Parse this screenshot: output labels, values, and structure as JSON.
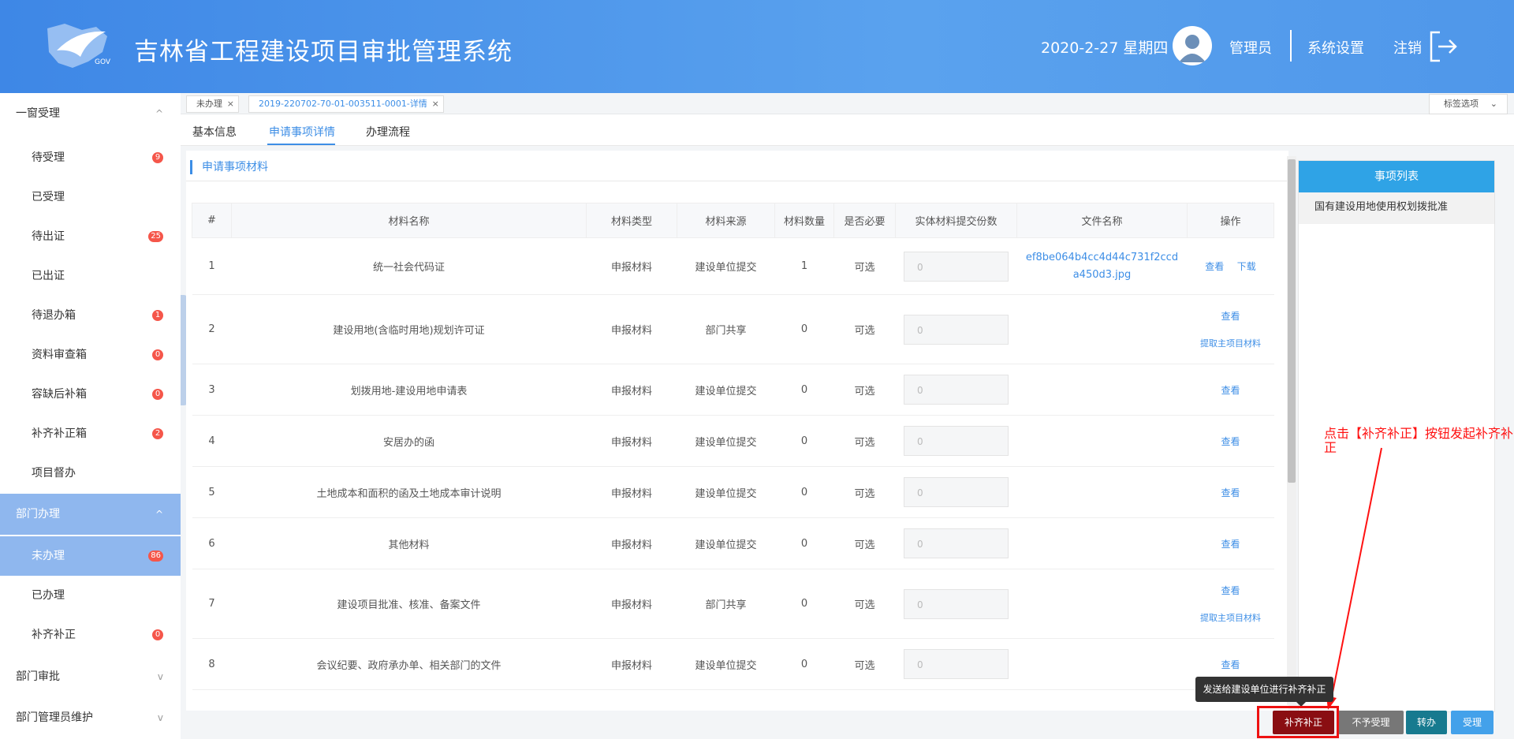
{
  "header": {
    "title": "吉林省工程建设项目审批管理系统",
    "logo_text": "GOV",
    "date": "2020-2-27 星期四",
    "user": "管理员",
    "settings": "系统设置",
    "logout": "注销"
  },
  "sidebar": {
    "groups": [
      {
        "label": "一窗受理",
        "chevron": "^",
        "items": [
          {
            "label": "待受理",
            "badge": "9"
          },
          {
            "label": "已受理",
            "badge": ""
          },
          {
            "label": "待出证",
            "badge": "25"
          },
          {
            "label": "已出证",
            "badge": ""
          },
          {
            "label": "待退办箱",
            "badge": "1"
          },
          {
            "label": "资料审查箱",
            "badge": "0"
          },
          {
            "label": "容缺后补箱",
            "badge": "0"
          },
          {
            "label": "补齐补正箱",
            "badge": "2"
          },
          {
            "label": "项目督办",
            "badge": ""
          }
        ]
      },
      {
        "label": "部门办理",
        "chevron": "^",
        "items": [
          {
            "label": "未办理",
            "badge": "86"
          },
          {
            "label": "已办理",
            "badge": ""
          },
          {
            "label": "补齐补正",
            "badge": "0"
          }
        ]
      },
      {
        "label": "部门审批",
        "chevron": "v"
      },
      {
        "label": "部门管理员维护",
        "chevron": "v"
      }
    ]
  },
  "tabs": [
    {
      "label": "未办理",
      "close": "×"
    },
    {
      "label": "2019-220702-70-01-003511-0001-详情",
      "close": "×"
    }
  ],
  "tab_options": "标签选项",
  "subtabs": [
    "基本信息",
    "申请事项详情",
    "办理流程"
  ],
  "section_title": "申请事项材料",
  "table": {
    "headers": [
      "#",
      "材料名称",
      "材料类型",
      "材料来源",
      "材料数量",
      "是否必要",
      "实体材料提交份数",
      "文件名称",
      "操作"
    ],
    "rows": [
      {
        "no": "1",
        "name": "统一社会代码证",
        "type": "申报材料",
        "source": "建设单位提交",
        "count": "1",
        "required": "可选",
        "copies": "0",
        "file": "ef8be064b4cc4d44c731f2ccda450d3.jpg",
        "ops": [
          "查看",
          "下载"
        ]
      },
      {
        "no": "2",
        "name": "建设用地(含临时用地)规划许可证",
        "type": "申报材料",
        "source": "部门共享",
        "count": "0",
        "required": "可选",
        "copies": "0",
        "file": "",
        "ops": [
          "查看",
          "提取主项目材料"
        ]
      },
      {
        "no": "3",
        "name": "划拨用地-建设用地申请表",
        "type": "申报材料",
        "source": "建设单位提交",
        "count": "0",
        "required": "可选",
        "copies": "0",
        "file": "",
        "ops": [
          "查看"
        ]
      },
      {
        "no": "4",
        "name": "安居办的函",
        "type": "申报材料",
        "source": "建设单位提交",
        "count": "0",
        "required": "可选",
        "copies": "0",
        "file": "",
        "ops": [
          "查看"
        ]
      },
      {
        "no": "5",
        "name": "土地成本和面积的函及土地成本审计说明",
        "type": "申报材料",
        "source": "建设单位提交",
        "count": "0",
        "required": "可选",
        "copies": "0",
        "file": "",
        "ops": [
          "查看"
        ]
      },
      {
        "no": "6",
        "name": "其他材料",
        "type": "申报材料",
        "source": "建设单位提交",
        "count": "0",
        "required": "可选",
        "copies": "0",
        "file": "",
        "ops": [
          "查看"
        ]
      },
      {
        "no": "7",
        "name": "建设项目批准、核准、备案文件",
        "type": "申报材料",
        "source": "部门共享",
        "count": "0",
        "required": "可选",
        "copies": "0",
        "file": "",
        "ops": [
          "查看",
          "提取主项目材料"
        ]
      },
      {
        "no": "8",
        "name": "会议纪要、政府承办单、相关部门的文件",
        "type": "申报材料",
        "source": "建设单位提交",
        "count": "0",
        "required": "可选",
        "copies": "0",
        "file": "",
        "ops": [
          "查看"
        ]
      }
    ]
  },
  "right_panel": {
    "title": "事项列表",
    "items": [
      "国有建设用地使用权划拨批准"
    ]
  },
  "tooltip": "发送给建设单位进行补齐补正",
  "buttons": {
    "supplement": "补齐补正",
    "reject": "不予受理",
    "transfer": "转办",
    "accept": "受理"
  },
  "annotation": "点击【补齐补正】按钮发起补齐补正",
  "colors": {
    "header": "#4a93ea",
    "accent": "#3d8ee6",
    "badge": "#f5564a",
    "annotation": "#ff1111"
  }
}
